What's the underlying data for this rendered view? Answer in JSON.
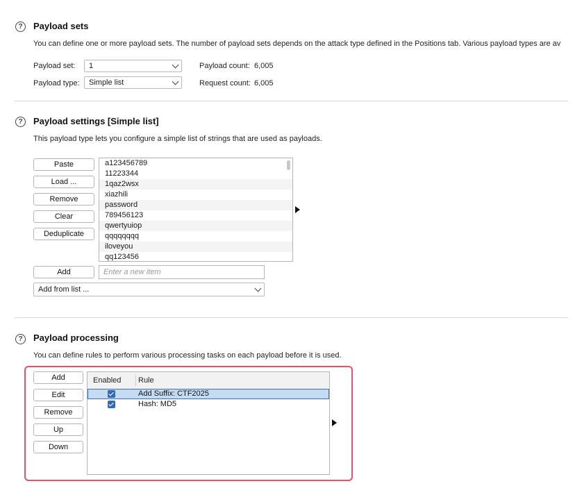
{
  "payload_sets": {
    "title": "Payload sets",
    "description": "You can define one or more payload sets. The number of payload sets depends on the attack type defined in the Positions tab. Various payload types are av",
    "set_label": "Payload set:",
    "set_value": "1",
    "type_label": "Payload type:",
    "type_value": "Simple list",
    "count_label": "Payload count:",
    "count_value": "6,005",
    "request_label": "Request count:",
    "request_value": "6,005"
  },
  "payload_settings": {
    "title": "Payload settings [Simple list]",
    "description": "This payload type lets you configure a simple list of strings that are used as payloads.",
    "buttons": {
      "paste": "Paste",
      "load": "Load ...",
      "remove": "Remove",
      "clear": "Clear",
      "deduplicate": "Deduplicate",
      "add": "Add"
    },
    "items": [
      "a123456789",
      "11223344",
      "1qaz2wsx",
      "xiazhili",
      "password",
      "789456123",
      "qwertyuiop",
      "qqqqqqqq",
      "iloveyou",
      "qq123456"
    ],
    "new_item_placeholder": "Enter a new item",
    "add_from_list": "Add from list ..."
  },
  "payload_processing": {
    "title": "Payload processing",
    "description": "You can define rules to perform various processing tasks on each payload before it is used.",
    "buttons": {
      "add": "Add",
      "edit": "Edit",
      "remove": "Remove",
      "up": "Up",
      "down": "Down"
    },
    "columns": {
      "enabled": "Enabled",
      "rule": "Rule"
    },
    "rules": [
      {
        "enabled": true,
        "rule": "Add Suffix: CTF2025",
        "selected": true
      },
      {
        "enabled": true,
        "rule": "Hash: MD5",
        "selected": false
      }
    ]
  },
  "colors": {
    "highlight_border": "#e5506b",
    "selected_row": "#c5dbf2",
    "checkbox": "#2f6cb5"
  }
}
